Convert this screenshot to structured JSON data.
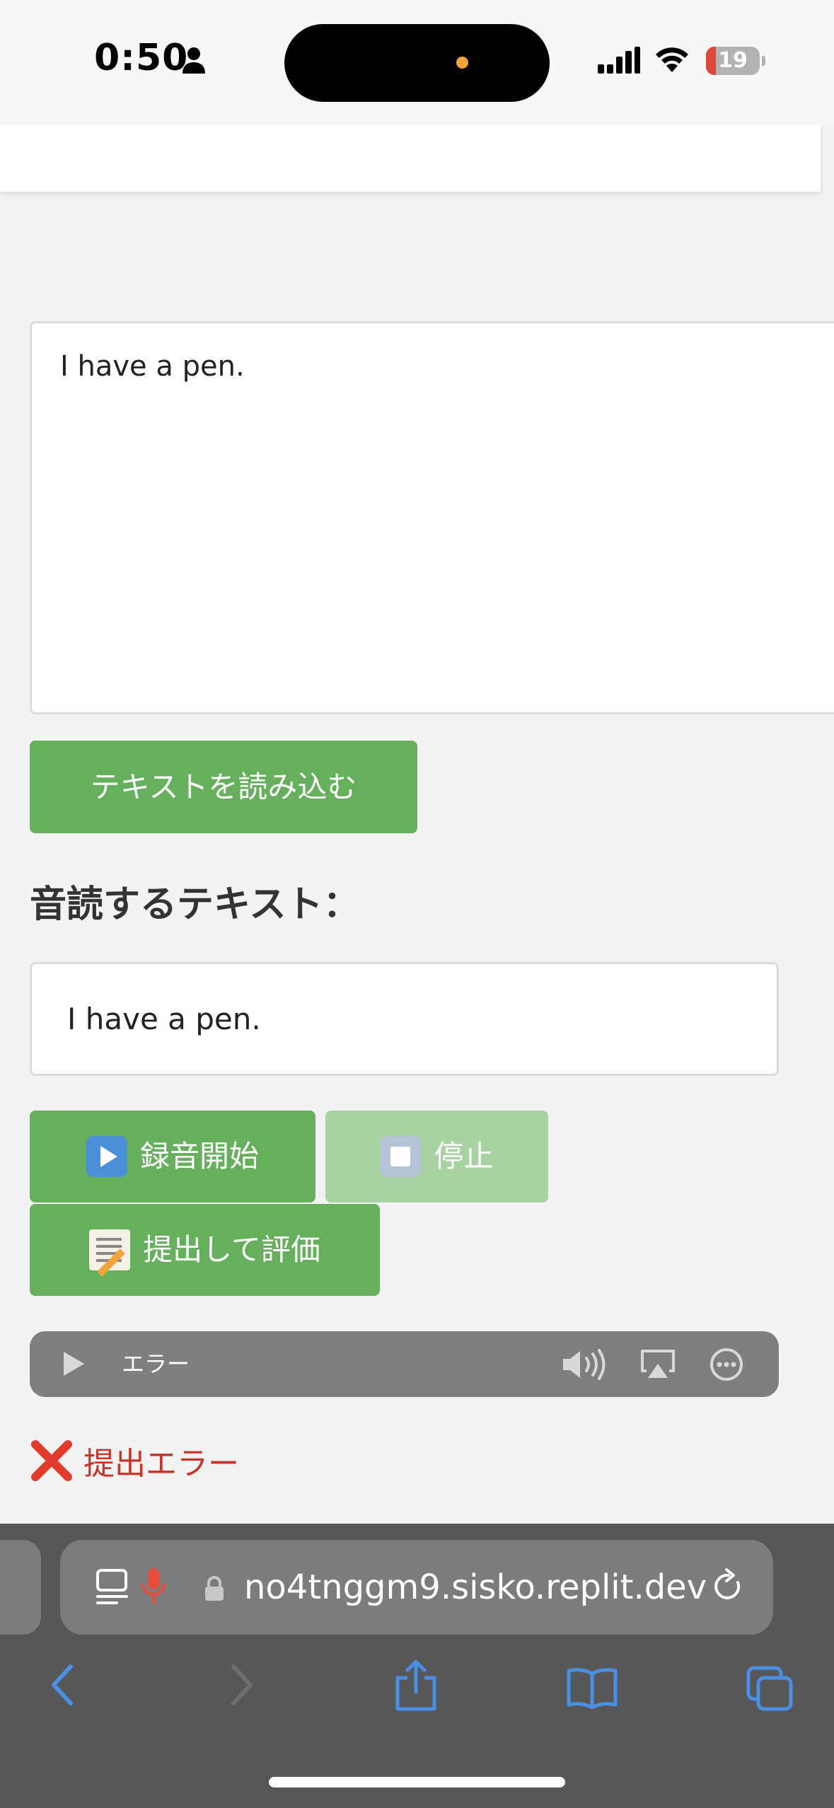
{
  "status_bar": {
    "time": "0:50",
    "battery_percent": "19",
    "battery_level": 0.19,
    "colors": {
      "battery_low": "#e0473c",
      "island_dot": "#f2a33a"
    }
  },
  "main": {
    "text_input_value": "I have a pen.",
    "load_button_label": "テキストを読み込む",
    "reading_heading": "音読するテキスト：",
    "reading_text": "I have a pen.",
    "record_button_label": "録音開始",
    "stop_button_label": "停止",
    "submit_button_label": "提出して評価",
    "audio_player": {
      "status": "エラー"
    },
    "error_message": "提出エラー"
  },
  "browser": {
    "url": "no4tnggm9.sisko.replit.dev",
    "icons": [
      "reader-icon",
      "mic-icon",
      "lock-icon",
      "reload-icon",
      "back-icon",
      "forward-icon",
      "share-icon",
      "bookmarks-icon",
      "tabs-icon"
    ]
  },
  "colors": {
    "button_green": "#66b05d",
    "button_disabled": "#a9d2a2",
    "error_red": "#c9342b",
    "toolbar_blue": "#4a8fe6"
  }
}
